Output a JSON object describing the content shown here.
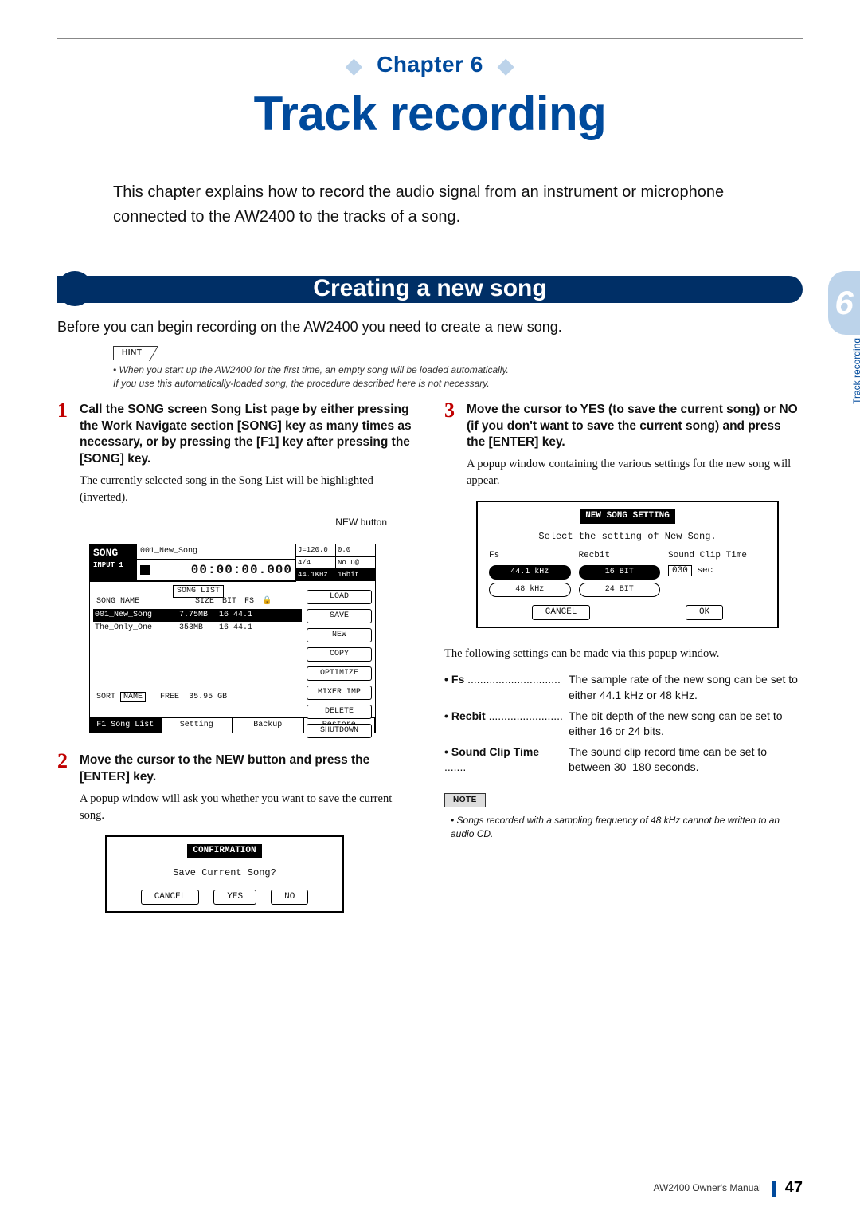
{
  "chapter_label": "Chapter 6",
  "chapter_title": "Track recording",
  "intro": "This chapter explains how to record the audio signal from an instrument or microphone connected to the AW2400 to the tracks of a song.",
  "section_title": "Creating a new song",
  "lede": "Before you can begin recording on the AW2400 you need to create a new song.",
  "hint_tag": "HINT",
  "hint_lines": [
    "• When you start up the AW2400 for the first time, an empty song will be loaded automatically.",
    "  If you use this automatically-loaded song, the procedure described here is not necessary."
  ],
  "steps": {
    "s1": {
      "num": "1",
      "title": "Call the SONG screen Song List page by either pressing the Work Navigate section [SONG] key as many times as necessary, or by pressing the [F1] key after pressing the [SONG] key.",
      "body": "The currently selected song in the Song List will be highlighted (inverted)."
    },
    "s2": {
      "num": "2",
      "title": "Move the cursor to the NEW button and press the [ENTER] key.",
      "body": "A popup window will ask you whether you want to save the current song."
    },
    "s3": {
      "num": "3",
      "title": "Move the cursor to YES (to save the current song) or NO (if you don't want to save the current song) and press the [ENTER] key.",
      "body": "A popup window containing the various settings for the new song will appear."
    }
  },
  "callout_new": "NEW button",
  "lcd": {
    "tab_left_top": "SONG",
    "tab_left_bot": "INPUT 1",
    "song_name_top": "001_New_Song",
    "time": "00:00:00.000",
    "meta_tempo": "J=120.0",
    "meta_sig": "4/4",
    "meta_click": "0.0",
    "meta_nodb": "No D@",
    "meta_rate": "44.1KHz",
    "meta_bit": "16bit",
    "list_label": "SONG LIST",
    "list_hdr": [
      "SONG NAME",
      "SIZE",
      "BIT",
      "FS",
      "",
      "🔒"
    ],
    "rows": [
      {
        "name": "001_New_Song",
        "size": "7.75MB",
        "bit": "16",
        "fs": "44.1",
        "sel": true
      },
      {
        "name": "The_Only_One",
        "size": "353MB",
        "bit": "16",
        "fs": "44.1",
        "sel": false
      }
    ],
    "buttons": [
      "LOAD",
      "SAVE",
      "NEW",
      "COPY",
      "OPTIMIZE",
      "MIXER IMP",
      "DELETE",
      "SHUTDOWN"
    ],
    "sort_label": "SORT",
    "sort_val": "NAME",
    "free_label": "FREE",
    "free_val": "35.95 GB",
    "tabs": [
      "F1 Song List",
      "Setting",
      "Backup",
      "Restore"
    ]
  },
  "confirm": {
    "hdr": "CONFIRMATION",
    "msg": "Save Current Song?",
    "btns": [
      "CANCEL",
      "YES",
      "NO"
    ]
  },
  "new_song": {
    "hdr": "NEW SONG SETTING",
    "msg": "Select the setting of New Song.",
    "col_fs": "Fs",
    "col_recbit": "Recbit",
    "col_sct": "Sound Clip Time",
    "fs_1": "44.1 kHz",
    "fs_2": "48 kHz",
    "rb_1": "16 BIT",
    "rb_2": "24 BIT",
    "sct_val": "030",
    "sct_unit": "sec",
    "ok": "OK",
    "cancel": "CANCEL"
  },
  "popup_intro": "The following settings can be made via this popup window.",
  "defs": {
    "d1": {
      "term": "Fs",
      "dots": "..............................",
      "def": "The sample rate of the new song can be set to either 44.1 kHz or 48 kHz."
    },
    "d2": {
      "term": "Recbit",
      "dots": "........................",
      "def": "The bit depth of the new song can be set to either 16 or 24 bits."
    },
    "d3": {
      "term": "Sound Clip Time",
      "dots": ".......",
      "def": "The sound clip record time can be set to between 30–180 seconds."
    }
  },
  "note_tag": "NOTE",
  "note_text": "• Songs recorded with a sampling frequency of 48 kHz cannot be written to an audio CD.",
  "thumb_num": "6",
  "thumb_label": "Track recording",
  "footer_text": "AW2400  Owner's Manual",
  "footer_page": "47"
}
